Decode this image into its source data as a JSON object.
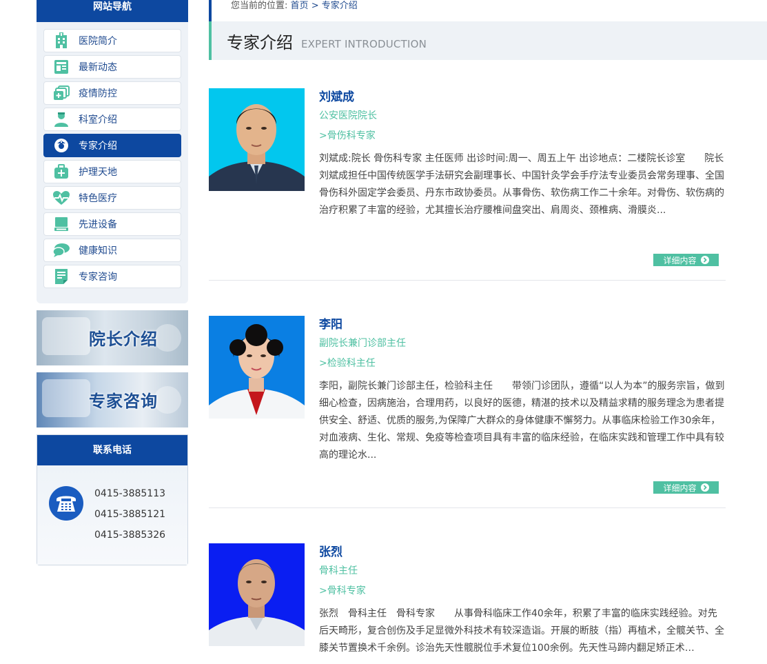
{
  "sidebar": {
    "nav_title": "网站导航",
    "items": [
      {
        "label": "医院简介",
        "icon": "hospital-building-icon"
      },
      {
        "label": "最新动态",
        "icon": "news-icon"
      },
      {
        "label": "疫情防控",
        "icon": "epidemic-control-icon"
      },
      {
        "label": "科室介绍",
        "icon": "department-doctor-icon"
      },
      {
        "label": "专家介绍",
        "icon": "nurse-icon",
        "active": true
      },
      {
        "label": "护理天地",
        "icon": "medical-kit-icon"
      },
      {
        "label": "特色医疗",
        "icon": "heart-pulse-icon"
      },
      {
        "label": "先进设备",
        "icon": "equipment-icon"
      },
      {
        "label": "健康知识",
        "icon": "chat-bubbles-icon"
      },
      {
        "label": "专家咨询",
        "icon": "consult-document-icon"
      }
    ],
    "banners": [
      {
        "text": "院长介绍"
      },
      {
        "text": "专家咨询"
      }
    ],
    "contact": {
      "title": "联系电话",
      "phones": [
        "0415-3885113",
        "0415-3885121",
        "0415-3885326"
      ]
    }
  },
  "breadcrumb": {
    "prefix": "您当前的位置:",
    "home": "首页",
    "separator": ">",
    "current": "专家介绍"
  },
  "page": {
    "title_cn": "专家介绍",
    "title_en": "EXPERT INTRODUCTION"
  },
  "more_label": "详细内容",
  "experts": [
    {
      "name": "刘斌成",
      "title": "公安医院院长",
      "specialty": ">骨伤科专家",
      "desc": "刘斌成:院长 骨伤科专家 主任医师 出诊时间:周一、周五上午 出诊地点：二楼院长诊室　　院长刘斌成担任中国传统医学手法研究会副理事长、中国针灸学会手疗法专业委员会常务理事、全国骨伤科外固定学会委员、丹东市政协委员。从事骨伤、软伤病工作二十余年。对骨伤、软伤病的治疗积累了丰富的经验，尤其擅长治疗腰椎间盘突出、肩周炎、颈椎病、滑膜炎...",
      "photo_bg": "#02c7ee",
      "uniform": "#27364f"
    },
    {
      "name": "李阳",
      "title": "副院长兼门诊部主任",
      "specialty": ">检验科主任",
      "desc": "李阳，副院长兼门诊部主任，检验科主任　　带领门诊团队，遵循“以人为本”的服务宗旨，做到细心检查，因病施治，合理用药，以良好的医德，精湛的技术以及精益求精的服务理念为患者提供安全、舒适、优质的服务,为保障广大群众的身体健康不懈努力。从事临床检验工作30余年，对血液病、生化、常规、免疫等检查项目具有丰富的临床经验，在临床实践和管理工作中具有较高的理论水...",
      "photo_bg": "#0a7fe3",
      "uniform": "#f4f6f8"
    },
    {
      "name": "张烈",
      "title": "骨科主任",
      "specialty": ">骨科专家",
      "desc": "张烈　骨科主任　骨科专家　　从事骨科临床工作40余年，积累了丰富的临床实践经验。对先后天畸形，复合创伤及手足显微外科技术有较深造诣。开展的断肢（指）再植术，全髋关节、全膝关节置换术千余例。诊治先天性髋脱位手术复位100余例。先天性马蹄内翻足矫正术…",
      "photo_bg": "#0a1ef2",
      "uniform": "#e9edf1"
    }
  ]
}
